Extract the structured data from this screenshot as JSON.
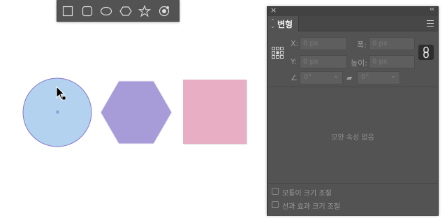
{
  "toolbar": {
    "tools": [
      {
        "icon": "rectangle-icon"
      },
      {
        "icon": "rounded-rectangle-icon"
      },
      {
        "icon": "ellipse-icon"
      },
      {
        "icon": "polygon-icon"
      },
      {
        "icon": "star-icon"
      },
      {
        "icon": "flare-icon"
      }
    ]
  },
  "canvas": {
    "shapes": [
      {
        "type": "circle",
        "fill": "#b3d2ef",
        "stroke": "#8478c9"
      },
      {
        "type": "hexagon",
        "fill": "#a79cd7"
      },
      {
        "type": "square",
        "fill": "#e8afc4"
      }
    ]
  },
  "panel": {
    "close_glyph": "×",
    "collapse_glyph": "‹‹",
    "tab_arrows": "⌃⌄",
    "tab_label": "변형",
    "x_label": "X:",
    "x_value": "0 px",
    "width_label": "폭:",
    "width_value": "0 px",
    "y_label": "Y:",
    "y_value": "0 px",
    "height_label": "높이:",
    "height_value": "0 px",
    "angle_value": "0°",
    "shear_value": "0°",
    "no_props_text": "모양 속성 없음",
    "scale_corners_label": "모퉁이 크기 조절",
    "scale_strokes_label": "선과 효과 크기 조절"
  },
  "colors": {
    "panel_bg": "#535353",
    "toolbar_bg": "#535353",
    "field_bg": "#5e5e5e"
  }
}
